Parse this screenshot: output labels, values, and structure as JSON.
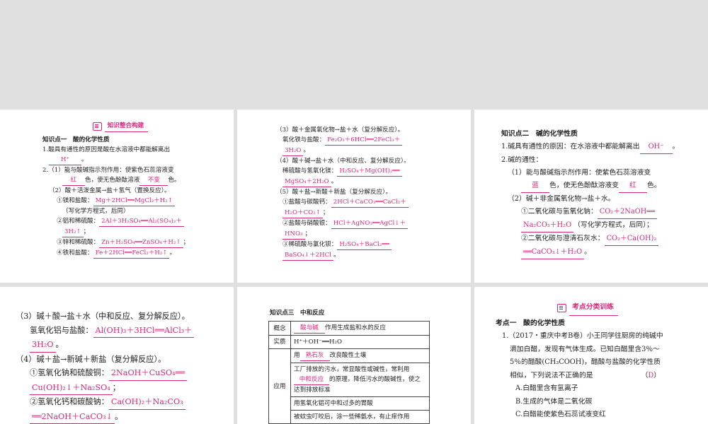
{
  "p1": {
    "banner": "知识整合构建",
    "kp_title": "知识点一　酸的化学性质",
    "l1": "1.酸具有通性的原因是酸在水溶液中都能解离出",
    "a1": "H⁺",
    "l2": "2.（1）能与酸碱指示剂作用：使紫色石蕊溶液变",
    "a2": "红",
    "l3": "色，使无色酚酞溶液",
    "a3": "不变",
    "l3b": "色。",
    "l4": "（2）酸＋活泼金属→盐＋氢气（置换反应）。",
    "r1": "①镁和盐酸：",
    "r1a": "Mg＋2HCl══MgCl₂＋H₂↑",
    "r1n": "（写化学方程式，后同）",
    "r2": "②铝和稀硫酸：",
    "r2a": "2Al＋3H₂SO₄══Al₂(SO₄)₃＋",
    "r2b": "3H₂↑",
    "r3": "③锌和稀硫酸：",
    "r3a": "Zn＋H₂SO₄══ZnSO₄＋H₂↑",
    "r4": "④铁和盐酸：",
    "r4a": "Fe＋2HCl══FeCl₂＋H₂↑"
  },
  "p2": {
    "l1": "（3）酸＋金属氧化物→盐＋水（复分解反应）。",
    "r1": "氧化铁与盐酸：",
    "r1a": "Fe₂O₃＋6HCl══2FeCl₃＋",
    "r1b": "3H₂O",
    "l2": "（4）酸＋碱→盐＋水（中和反应、复分解反应）。",
    "r2": "稀硫酸与氢氧化镁：",
    "r2a": "H₂SO₄＋Mg(OH)₂══",
    "r2b": "MgSO₄＋2H₂O",
    "l3": "（5）酸＋盐→新酸＋新盐（复分解反应）。",
    "r3": "①盐酸与碳酸钙：",
    "r3a": "2HCl＋CaCO₃══CaCl₂＋",
    "r3b": "H₂O＋CO₂↑",
    "r4": "②盐酸与硝酸银：",
    "r4a": "HCl＋AgNO₃══AgCl↓＋",
    "r4b": "HNO₃",
    "r5": "③稀硫酸与氯化钡：",
    "r5a": "H₂SO₄＋BaCl₂══",
    "r5b": "BaSO₄↓＋2HCl"
  },
  "p3": {
    "kp_title": "知识点二　碱的化学性质",
    "l1": "1.碱具有通性的原因：在水溶液中都能解离出",
    "a1": "OH⁻",
    "l2": "2.碱的通性：",
    "l3": "（1）能与酸碱指示剂作用：使紫色石蕊溶液变",
    "a2": "蓝",
    "l4": "色，使无色酚酞溶液变",
    "a3": "红",
    "l4b": "色。",
    "l5": "（2）碱＋非金属氧化物→盐＋水。",
    "r1": "①二氧化碳与氢氧化钠：",
    "r1a": "CO₂＋2NaOH══",
    "r1b": "Na₂CO₃＋H₂O",
    "r1n": "（写化学方程式，后同）",
    "r2": "②二氧化碳与澄清石灰水：",
    "r2a": "CO₂＋Ca(OH)₂",
    "r2b": "══CaCO₃↓＋H₂O"
  },
  "p4": {
    "l1": "（3）碱＋酸→盐＋水（中和反应、复分解反应）。",
    "r1": "氢氧化铝与盐酸：",
    "r1a": "Al(OH)₃＋3HCl══AlCl₃＋",
    "r1b": "3H₂O",
    "l2": "（4）碱＋盐→新碱＋新盐（复分解反应）。",
    "r2": "①氢氧化钠和硫酸铜：",
    "r2a": "2NaOH＋CuSO₄══",
    "r2b": "Cu(OH)₂↓＋Na₂SO₄",
    "r3": "②氢氧化钙和碳酸钠：",
    "r3a": "Ca(OH)₂＋Na₂CO₃",
    "r3b": "══2NaOH＋CaCO₃↓"
  },
  "p5": {
    "kp_title": "知识点三　中和反应",
    "row1_h": "概念",
    "row1_a": "酸与碱",
    "row1_t": "作用生成盐和水的反应",
    "row2_h": "实质",
    "row2_t": "H⁺＋OH⁻══H₂O",
    "row3_h": "应用",
    "app1_pre": "用",
    "app1_a": "熟石灰",
    "app1_post": "改良酸性土壤",
    "app2_pre": "工厂排放的污水，常显酸性或碱性，常利用",
    "app2_a": "中和反应",
    "app2_post": "的原理，降低污水的酸碱性，使之达到排放标准",
    "app3": "用氢氧化铝可中和过多的胃酸",
    "app4": "被蚊虫叮咬后，涂一些稀氨水，有止痒作用"
  },
  "p6": {
    "banner": "考点分类训练",
    "kp_title": "考点一　酸的化学性质",
    "q1_num": "1.",
    "q1_src": "（2017・重庆中考B卷）",
    "q1_text1": "小王同学往厨房的纯碱中",
    "q1_text2": "滴加白醋，发现有气体生成。已知白醋里含3％～",
    "q1_text3": "5％的醋酸(CH₃COOH)，醋酸与盐酸的化学性质",
    "q1_text4": "相似，下列说法不正确的是",
    "q1_ans": "D",
    "optA": "A.白醋里含有氢离子",
    "optB": "B.生成的气体是二氧化碳",
    "optC": "C.白醋能使紫色石蕊试液变红"
  }
}
